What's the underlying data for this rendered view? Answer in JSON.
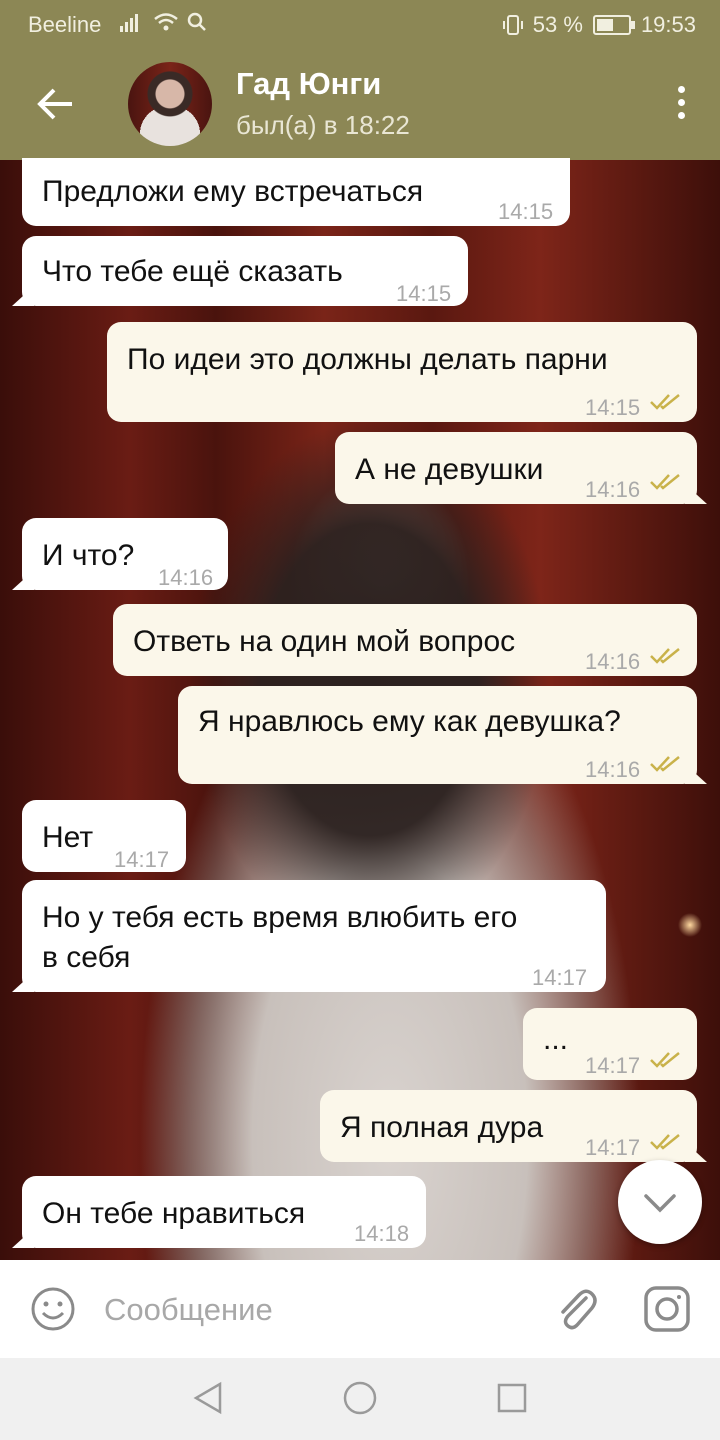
{
  "status_bar": {
    "carrier": "Beeline",
    "indicators": "W P",
    "battery": "53 %",
    "time": "19:53"
  },
  "header": {
    "contact_name": "Гад Юнги",
    "last_seen": "был(а) в 18:22"
  },
  "messages": [
    {
      "dir": "in",
      "text": "Предложи ему встречаться",
      "time": "14:15"
    },
    {
      "dir": "in",
      "text": "Что тебе ещё сказать",
      "time": "14:15"
    },
    {
      "dir": "out",
      "text": "По идеи это должны делать парни",
      "time": "14:15",
      "read": true
    },
    {
      "dir": "out",
      "text": "А не девушки",
      "time": "14:16",
      "read": true
    },
    {
      "dir": "in",
      "text": "И что?",
      "time": "14:16"
    },
    {
      "dir": "out",
      "text": "Ответь на один мой вопрос",
      "time": "14:16",
      "read": true
    },
    {
      "dir": "out",
      "text": "Я нравлюсь ему как девушка?",
      "time": "14:16",
      "read": true
    },
    {
      "dir": "in",
      "text": "Нет",
      "time": "14:17"
    },
    {
      "dir": "in",
      "text_line1": "Но у тебя есть время влюбить его",
      "text_line2": "в себя",
      "time": "14:17"
    },
    {
      "dir": "out",
      "text": "...",
      "time": "14:17",
      "read": true
    },
    {
      "dir": "out",
      "text": "Я полная дура",
      "time": "14:17",
      "read": true
    },
    {
      "dir": "in",
      "text": "Он тебе нравиться",
      "time": "14:18"
    }
  ],
  "composer": {
    "placeholder": "Сообщение"
  },
  "colors": {
    "header_bg": "#8c8755",
    "incoming_bubble": "#ffffff",
    "outgoing_bubble": "#fbf7ea",
    "read_check": "#c9b24a"
  }
}
